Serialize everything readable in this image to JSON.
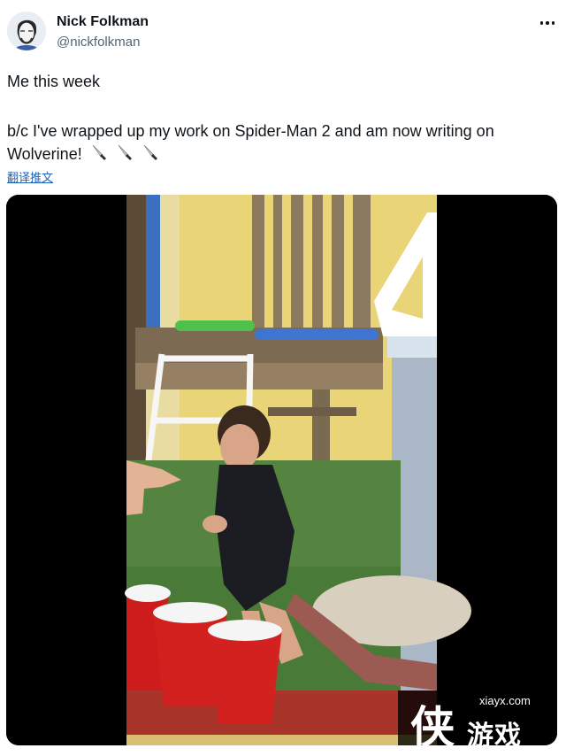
{
  "author": {
    "name": "Nick Folkman",
    "handle": "@nickfolkman"
  },
  "tweet": {
    "line1": "Me this week",
    "line2": "b/c I've wrapped up my work on Spider-Man 2 and am now writing on Wolverine!",
    "emoji": "knife-icon",
    "translate_label": "翻译推文"
  },
  "media": {
    "description_kind": "video-frame"
  },
  "watermark": {
    "url": "xiayx.com",
    "logo": "侠",
    "text": "游戏"
  }
}
